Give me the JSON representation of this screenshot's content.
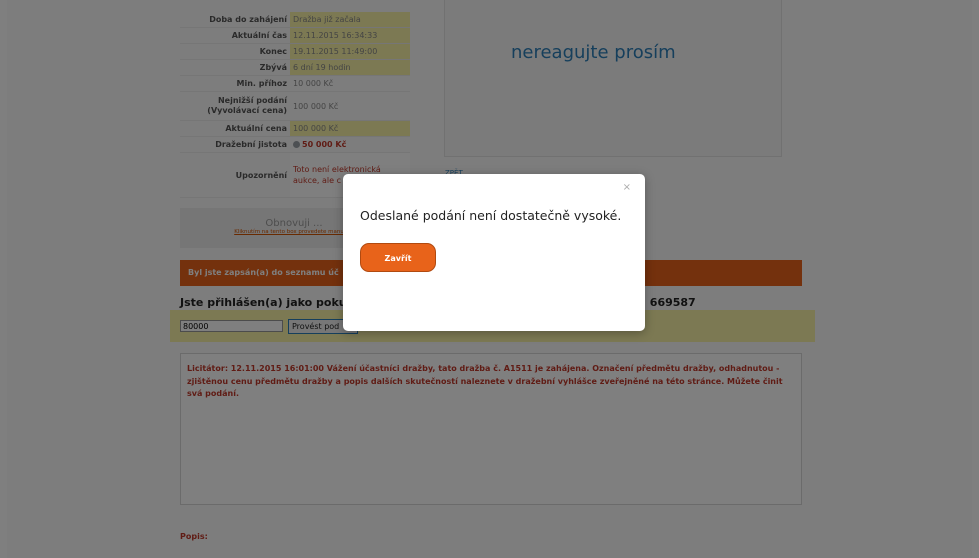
{
  "auction_info": [
    {
      "label": "Doba do zahájení",
      "value": "Dražba již začala",
      "style": "hl"
    },
    {
      "label": "Aktuální čas",
      "value": "12.11.2015 16:34:33",
      "style": "hl"
    },
    {
      "label": "Konec",
      "value": "19.11.2015 11:49:00",
      "style": "hl"
    },
    {
      "label": "Zbývá",
      "value": "6 dní 19 hodin",
      "style": "hl"
    },
    {
      "label": "Min. příhoz",
      "value": "10 000 Kč",
      "style": "plain"
    },
    {
      "label": "Nejnižší podání (Vyvolávací cena)",
      "value": "100 000 Kč",
      "style": "plain"
    },
    {
      "label": "Aktuální cena",
      "value": "100 000 Kč",
      "style": "hl"
    },
    {
      "label": "Dražební jistota",
      "value": "50 000 Kč",
      "style": "bold"
    },
    {
      "label": "Upozornění",
      "value": "Toto není elektronická aukce, ale c dle zák. 26/",
      "style": "red"
    }
  ],
  "notice_panel_text": "nereagujte prosím",
  "small_link": "ZPĚT",
  "refresh": {
    "title": "Obnovuji ...",
    "link": "Kliknutím na tento box provedete manuální"
  },
  "banner_text": "Byl jste zapsán(a) do seznamu úč",
  "logged_in_text": "Jste přihlášen(a) jako pokus73",
  "logged_in_right": "o: 669587",
  "bid": {
    "value": "80000",
    "button_label": "Provést pod"
  },
  "log_text": "Licitátor: 12.11.2015 16:01:00 Vážení účastníci dražby, tato dražba č. A1511 je zahájena. Označení předmětu dražby, odhadnutou - zjištěnou cenu předmětu dražby a popis dalších skutečností naleznete v dražební vyhlášce zveřejněné na této stránce. Můžete činit svá podání.",
  "popis_label": "Popis:",
  "modal": {
    "close": "×",
    "message": "Odeslané podání není dostatečně vysoké.",
    "button_label": "Zavřít"
  },
  "colors": {
    "accent": "#e8631a",
    "highlight": "#f8f3a6",
    "alert": "#c0392b",
    "link": "#2d7fb8"
  }
}
